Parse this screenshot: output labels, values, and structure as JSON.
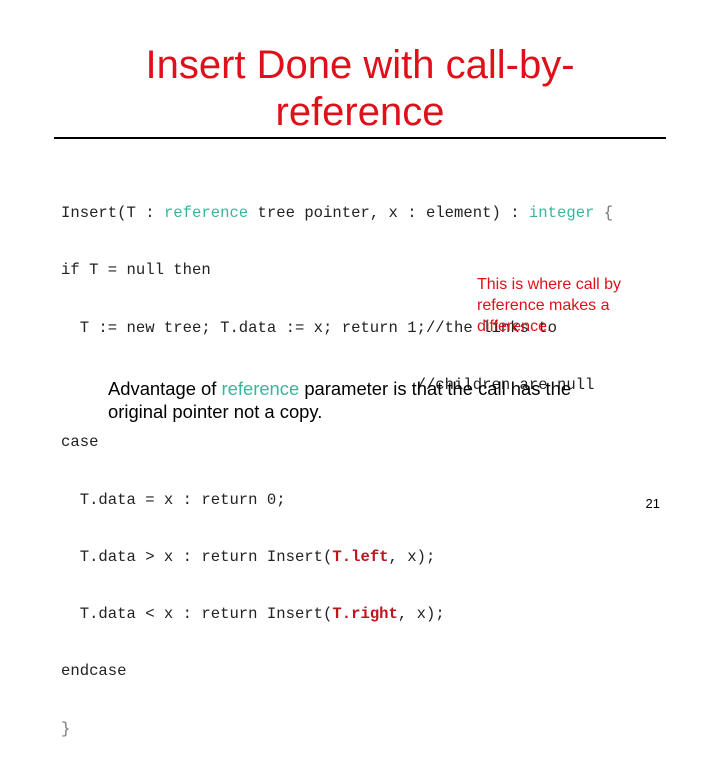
{
  "slide": {
    "title": "Insert Done with call-by-reference",
    "title_line1": "Insert Done with call-by-",
    "title_line2": "reference",
    "page_number": "21",
    "colors": {
      "title": "#e0101a",
      "keyword": "#3cb49c",
      "highlight": "#c0141c",
      "text": "#000000"
    }
  },
  "code": {
    "line1": {
      "before": "Insert(T : ",
      "keyword1": "reference",
      "middle": " tree pointer, x : element) : ",
      "keyword2": "integer",
      "after": " {"
    },
    "line2": "if T = null then",
    "line3": "  T := new tree; T.data := x; return 1;//the links to",
    "line4": "                                      //children are null",
    "line5": "case",
    "line6": "  T.data = x : return 0;",
    "line7": {
      "before": "  T.data > x : return Insert(",
      "highlight": "T.left",
      "after": ", x);"
    },
    "line8": {
      "before": "  T.data < x : return Insert(",
      "highlight": "T.right",
      "after": ", x);"
    },
    "line9": "endcase",
    "line10": "}"
  },
  "callout": {
    "text": "This is where call by reference makes a difference."
  },
  "note": {
    "before": "Advantage of ",
    "keyword": "reference",
    "after": " parameter is that the call has the original pointer not a copy."
  }
}
